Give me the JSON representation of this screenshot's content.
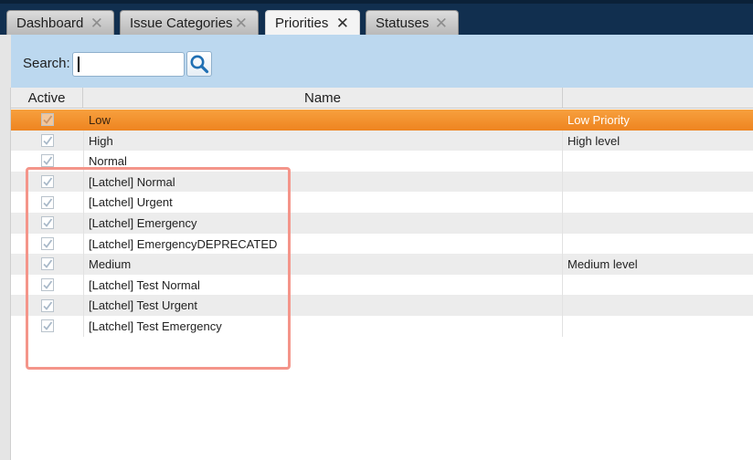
{
  "tabs": [
    {
      "label": "Dashboard",
      "active": false
    },
    {
      "label": "Issue Categories",
      "active": false
    },
    {
      "label": "Priorities",
      "active": true
    },
    {
      "label": "Statuses",
      "active": false
    }
  ],
  "search": {
    "label": "Search:",
    "value": "",
    "placeholder": ""
  },
  "columns": {
    "active": "Active",
    "name": "Name",
    "description": ""
  },
  "rows": [
    {
      "name": "Low",
      "description": "Low Priority",
      "active": true,
      "selected": true
    },
    {
      "name": "High",
      "description": "High level",
      "active": true
    },
    {
      "name": "Normal",
      "description": "",
      "active": true
    },
    {
      "name": "[Latchel] Normal",
      "description": "",
      "active": true
    },
    {
      "name": "[Latchel] Urgent",
      "description": "",
      "active": true
    },
    {
      "name": "[Latchel] Emergency",
      "description": "",
      "active": true
    },
    {
      "name": "[Latchel] EmergencyDEPRECATED",
      "description": "",
      "active": true
    },
    {
      "name": "Medium",
      "description": "Medium level",
      "active": true
    },
    {
      "name": "[Latchel] Test Normal",
      "description": "",
      "active": true
    },
    {
      "name": "[Latchel] Test Urgent",
      "description": "",
      "active": true
    },
    {
      "name": "[Latchel] Test Emergency",
      "description": "",
      "active": true
    }
  ],
  "icons": {
    "tab_close": "close-icon",
    "search": "search-icon",
    "check": "checkmark-icon"
  },
  "colors": {
    "selection": "#ee8420",
    "header_bar": "#112f4f",
    "search_bar": "#bcd8ef",
    "highlight_box": "#f4958a"
  }
}
